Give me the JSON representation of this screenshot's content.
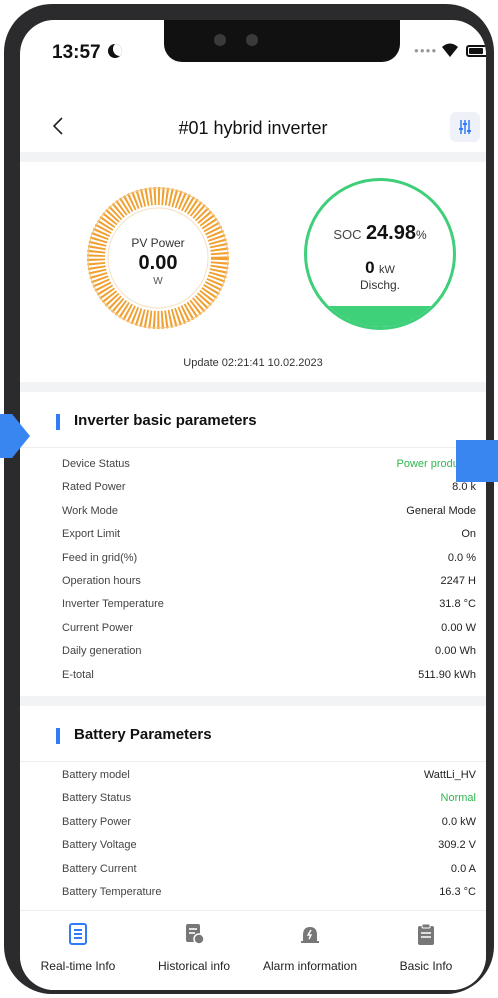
{
  "status_bar": {
    "time": "13:57"
  },
  "header": {
    "title": "#01 hybrid inverter"
  },
  "pv": {
    "label": "PV Power",
    "value": "0.00",
    "unit": "W"
  },
  "soc": {
    "label": "SOC",
    "value": "24.98",
    "unit": "%",
    "level_fraction": 0.2498,
    "power_value": "0",
    "power_unit": "kW",
    "state": "Dischg."
  },
  "update_text": "Update 02:21:41 10.02.2023",
  "colors": {
    "accent": "#2f7cf6",
    "green": "#3fcf7a",
    "orange": "#f0a030",
    "status_green": "#2fb84f"
  },
  "inverter_section": {
    "title": "Inverter basic parameters",
    "rows": [
      {
        "label": "Device Status",
        "value": "Power productio"
      },
      {
        "label": "Rated Power",
        "value": "8.0 k"
      },
      {
        "label": "Work Mode",
        "value": "General Mode"
      },
      {
        "label": "Export Limit",
        "value": "On"
      },
      {
        "label": "Feed in grid(%)",
        "value": "0.0 %"
      },
      {
        "label": "Operation hours",
        "value": "2247 H"
      },
      {
        "label": "Inverter Temperature",
        "value": "31.8 °C"
      },
      {
        "label": "Current Power",
        "value": "0.00 W"
      },
      {
        "label": "Daily generation",
        "value": "0.00 Wh"
      },
      {
        "label": "E-total",
        "value": "511.90 kWh"
      }
    ]
  },
  "battery_section": {
    "title": "Battery Parameters",
    "rows": [
      {
        "label": "Battery model",
        "value": "WattLi_HV"
      },
      {
        "label": "Battery Status",
        "value": "Normal"
      },
      {
        "label": "Battery Power",
        "value": "0.0 kW"
      },
      {
        "label": "Battery Voltage",
        "value": "309.2 V"
      },
      {
        "label": "Battery Current",
        "value": "0.0 A"
      },
      {
        "label": "Battery Temperature",
        "value": "16.3 °C"
      }
    ]
  },
  "nav": {
    "items": [
      {
        "label": "Real-time Info",
        "icon": "realtime-doc-icon",
        "active": true
      },
      {
        "label": "Historical info",
        "icon": "history-doc-icon"
      },
      {
        "label": "Alarm information",
        "icon": "alarm-bell-icon"
      },
      {
        "label": "Basic Info",
        "icon": "clipboard-icon"
      }
    ]
  }
}
